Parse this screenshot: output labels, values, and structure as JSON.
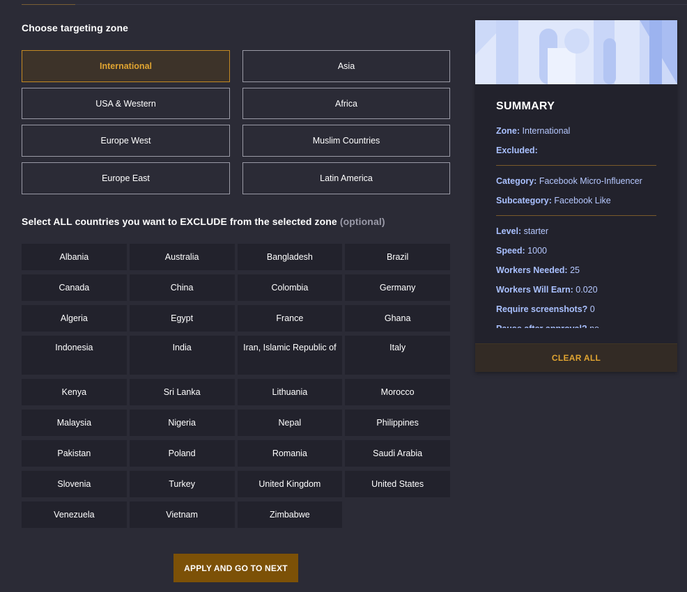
{
  "zone_section": {
    "title": "Choose targeting zone",
    "zones": [
      {
        "label": "International",
        "selected": true
      },
      {
        "label": "Asia",
        "selected": false
      },
      {
        "label": "USA & Western",
        "selected": false
      },
      {
        "label": "Africa",
        "selected": false
      },
      {
        "label": "Europe West",
        "selected": false
      },
      {
        "label": "Muslim Countries",
        "selected": false
      },
      {
        "label": "Europe East",
        "selected": false
      },
      {
        "label": "Latin America",
        "selected": false
      }
    ]
  },
  "exclude_section": {
    "title": "Select ALL countries you want to EXCLUDE from the selected zone",
    "optional": "(optional)",
    "countries": [
      "Albania",
      "Australia",
      "Bangladesh",
      "Brazil",
      "Canada",
      "China",
      "Colombia",
      "Germany",
      "Algeria",
      "Egypt",
      "France",
      "Ghana",
      "Indonesia",
      "India",
      "Iran, Islamic Republic of",
      "Italy",
      "Kenya",
      "Sri Lanka",
      "Lithuania",
      "Morocco",
      "Malaysia",
      "Nigeria",
      "Nepal",
      "Philippines",
      "Pakistan",
      "Poland",
      "Romania",
      "Saudi Arabia",
      "Slovenia",
      "Turkey",
      "United Kingdom",
      "United States",
      "Venezuela",
      "Vietnam",
      "Zimbabwe"
    ]
  },
  "apply_button": "APPLY AND GO TO NEXT",
  "summary": {
    "heading": "SUMMARY",
    "zone": {
      "key": "Zone:",
      "value": "International"
    },
    "excluded": {
      "key": "Excluded:",
      "value": ""
    },
    "category": {
      "key": "Category:",
      "value": "Facebook Micro-Influencer"
    },
    "subcategory": {
      "key": "Subcategory:",
      "value": "Facebook Like"
    },
    "level": {
      "key": "Level:",
      "value": "starter"
    },
    "speed": {
      "key": "Speed:",
      "value": "1000"
    },
    "workers_needed": {
      "key": "Workers Needed:",
      "value": "25"
    },
    "workers_earn": {
      "key": "Workers Will Earn:",
      "value": "0.020"
    },
    "screenshots": {
      "key": "Require screenshots?",
      "value": "0"
    },
    "pause": {
      "key": "Pause after approval?",
      "value": "no"
    },
    "clear_button": "CLEAR ALL"
  },
  "colors": {
    "background": "#2b2b36",
    "accent": "#e0a431",
    "apply_button": "#7c5107",
    "summary_link": "#b6c8ff"
  }
}
